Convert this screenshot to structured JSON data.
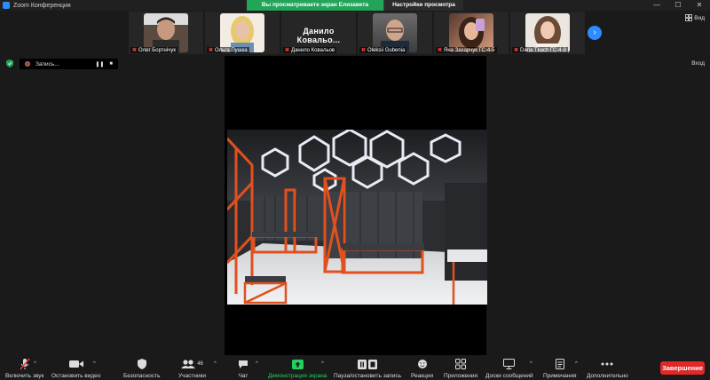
{
  "window": {
    "title": "Zoom Конференция"
  },
  "share_banner": {
    "message": "Вы просматриваете экран Елизавета Резенко",
    "options_label": "Настройки просмотра"
  },
  "window_controls": {
    "minimize": "—",
    "maximize": "☐",
    "close": "✕"
  },
  "view_top": {
    "label": "Вид"
  },
  "participants": [
    {
      "name": "Олег Бортнічук",
      "muted": true,
      "tone": "#5b4a40"
    },
    {
      "name": "Ольга Пушка",
      "muted": true,
      "tone": "#e9d9c6"
    },
    {
      "name": "Данило Ковальов",
      "display": "Данило  Ковальо...",
      "muted": true,
      "video": false
    },
    {
      "name": "Oleksii Gubenia",
      "muted": true,
      "tone": "#7a6a5e"
    },
    {
      "name": "Яна Захарчук ГС-4-5",
      "muted": true,
      "tone": "#b78a7a"
    },
    {
      "name": "Daria Tkach ГС-4-8",
      "muted": true,
      "tone": "#8a7060"
    }
  ],
  "next_page_icon": "chevron-right-icon",
  "recording": {
    "label": "Запись..."
  },
  "view_right": {
    "label": "Вход"
  },
  "toolbar": {
    "unmute": "Включить звук",
    "video": "Остановить видео",
    "security": "Безопасность",
    "participants": "Участники",
    "participants_count": "46",
    "chat": "Чат",
    "share": "Демонстрация экрана",
    "pause": "Пауза/остановить запись",
    "reactions": "Реакции",
    "apps": "Приложения",
    "whiteboard": "Доски сообщений",
    "notes": "Примечания",
    "more": "Дополнительно",
    "end": "Завершение"
  },
  "colors": {
    "accent": "#2d8cff",
    "share_green": "#23a559",
    "end_red": "#e02828",
    "locker_orange": "#e2501e"
  }
}
